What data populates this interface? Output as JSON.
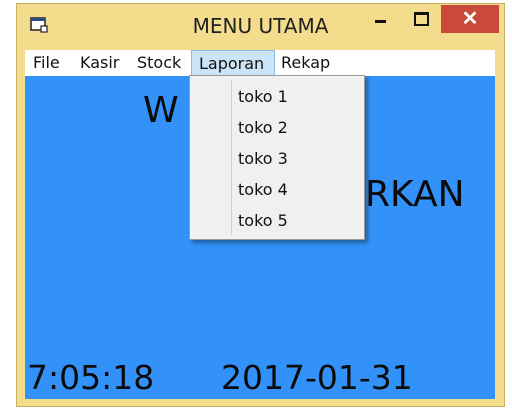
{
  "window": {
    "title": "MENU UTAMA",
    "close_label": "✕"
  },
  "menubar": {
    "items": [
      "File",
      "Kasir",
      "Stock",
      "Laporan",
      "Rekap"
    ],
    "active": "Laporan"
  },
  "dropdown": {
    "items": [
      "toko 1",
      "toko 2",
      "toko 3",
      "toko 4",
      "toko 5"
    ]
  },
  "main": {
    "welcome_fragment_left": "W",
    "welcome_fragment_right": "RKAN",
    "time": "7:05:18",
    "date": "2017-01-31"
  },
  "colors": {
    "titlebar": "#f3dc8c",
    "client_background": "#3392f9",
    "close_button": "#c94a3b",
    "menu_highlight": "#cce4f7"
  },
  "icons": {
    "app_icon": "app-window-icon"
  }
}
